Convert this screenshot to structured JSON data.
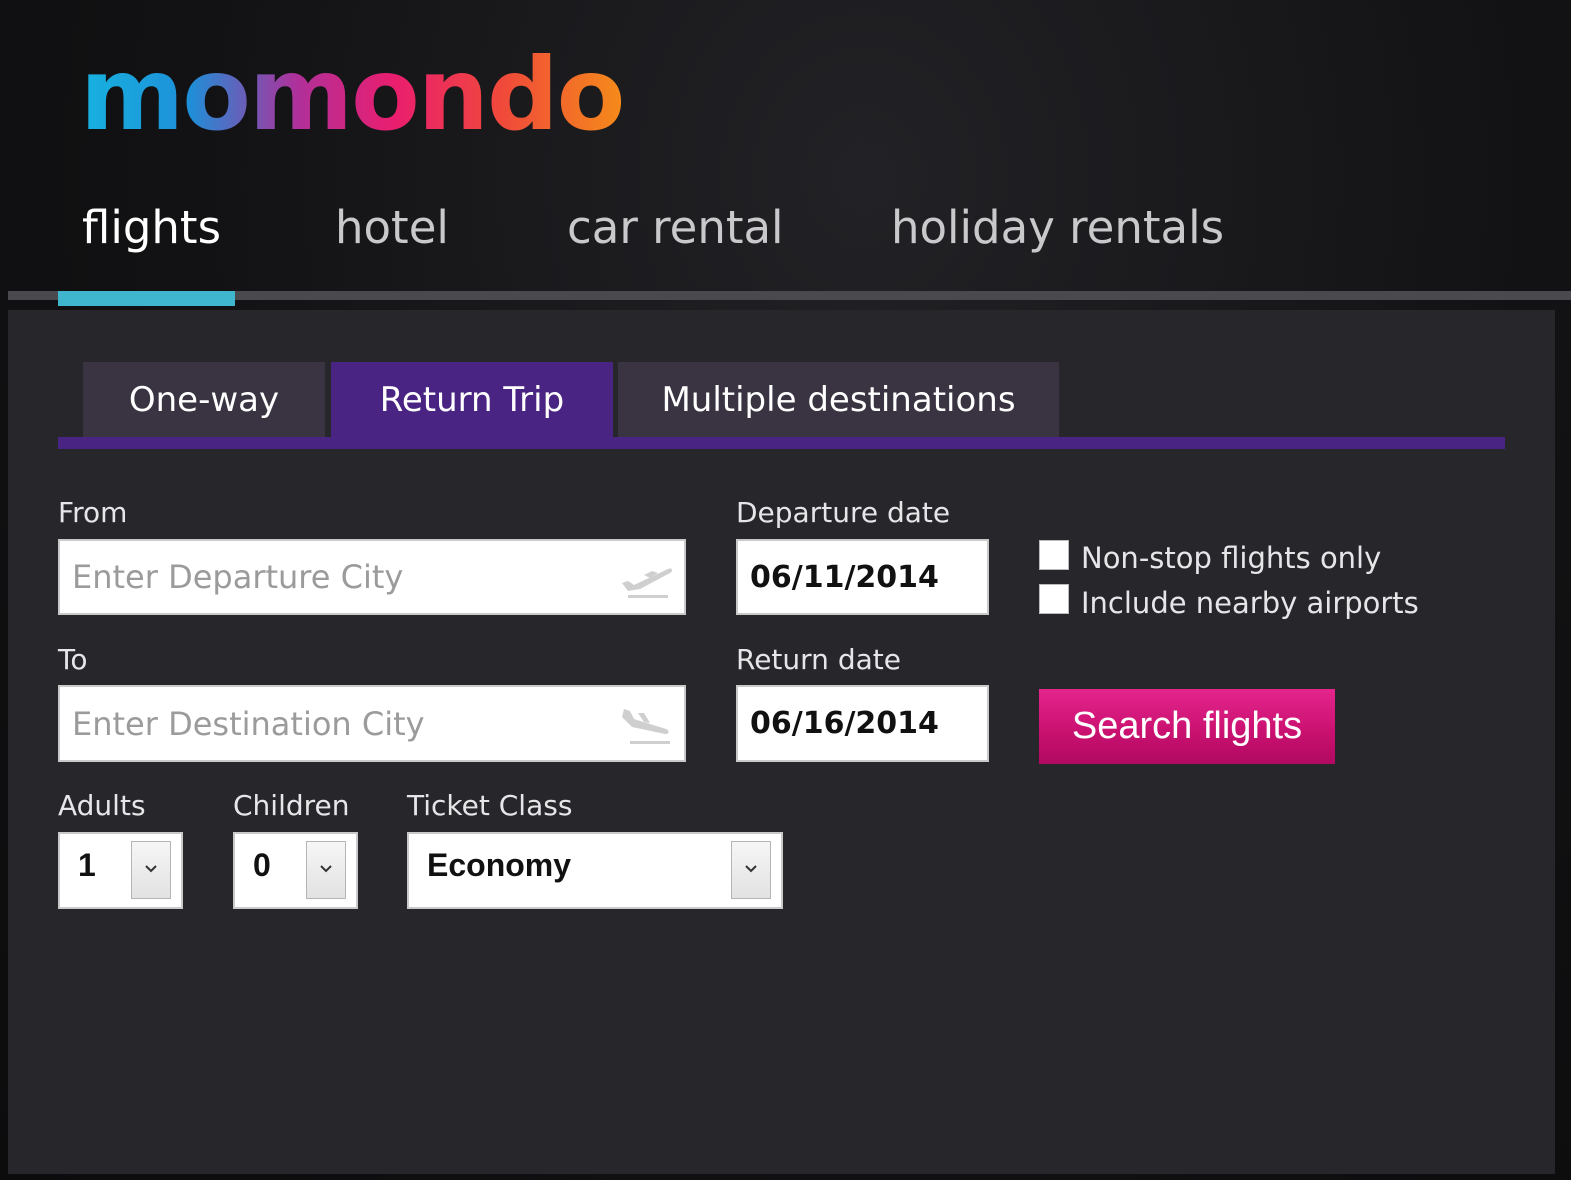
{
  "brand": {
    "logo_text": "momondo"
  },
  "topnav": {
    "items": [
      {
        "label": "flights",
        "active": true
      },
      {
        "label": "hotel",
        "active": false
      },
      {
        "label": "car rental",
        "active": false
      },
      {
        "label": "holiday rentals",
        "active": false
      }
    ]
  },
  "trip_tabs": {
    "items": [
      {
        "label": "One-way",
        "active": false
      },
      {
        "label": "Return Trip",
        "active": true
      },
      {
        "label": "Multiple destinations",
        "active": false
      }
    ]
  },
  "form": {
    "from": {
      "label": "From",
      "value": "",
      "placeholder": "Enter Departure City",
      "icon": "plane-takeoff-icon"
    },
    "to": {
      "label": "To",
      "value": "",
      "placeholder": "Enter Destination City",
      "icon": "plane-landing-icon"
    },
    "departure_date": {
      "label": "Departure date",
      "value": "06/11/2014"
    },
    "return_date": {
      "label": "Return date",
      "value": "06/16/2014"
    },
    "options": {
      "nonstop": {
        "label": "Non-stop flights only",
        "checked": false
      },
      "nearby": {
        "label": "Include nearby airports",
        "checked": false
      }
    },
    "search_button": {
      "label": "Search flights"
    },
    "adults": {
      "label": "Adults",
      "value": "1"
    },
    "children": {
      "label": "Children",
      "value": "0"
    },
    "ticket_class": {
      "label": "Ticket Class",
      "value": "Economy"
    }
  },
  "colors": {
    "accent_nav": "#3fb6cd",
    "tab_active": "#4a2483",
    "tab_inactive": "#3a3342",
    "search_button": "#c8106f",
    "panel_bg": "#27272b"
  }
}
